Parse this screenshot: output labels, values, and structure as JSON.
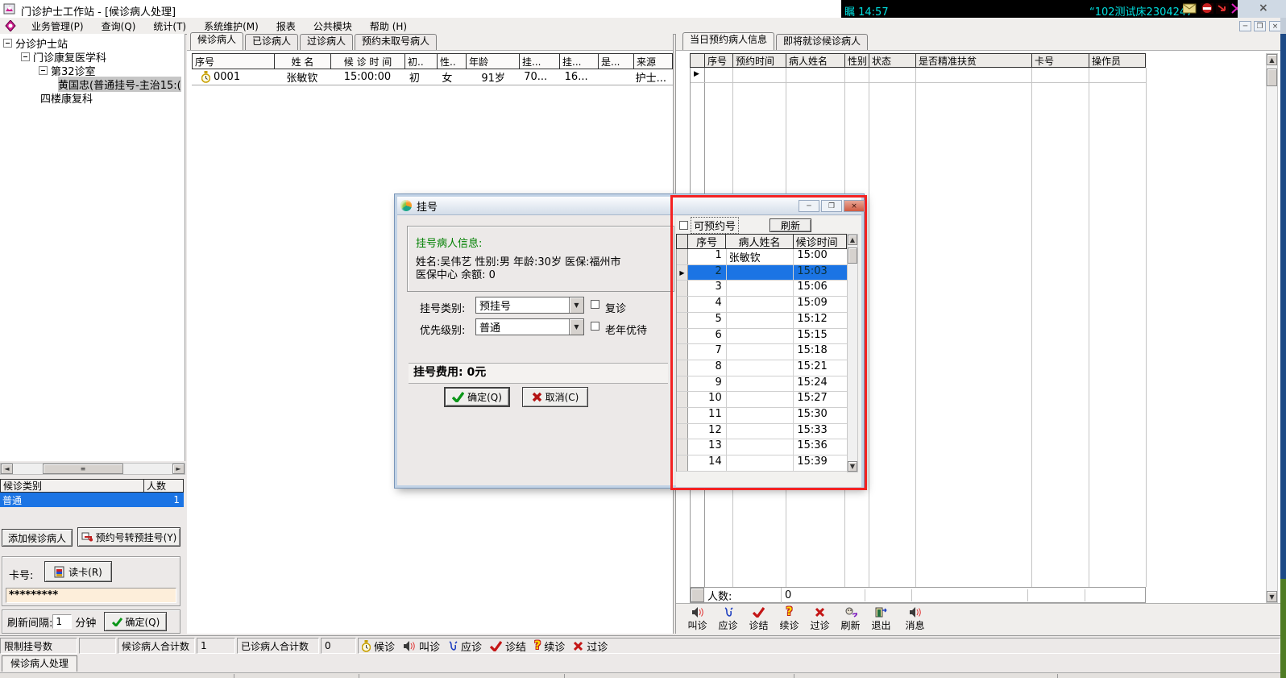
{
  "window": {
    "title": "门诊护士工作站 - [候诊病人处理]",
    "close_glyph": "×"
  },
  "tray": {
    "time": "瞩 14:57",
    "device": "“102测试床2304247"
  },
  "menu": [
    "业务管理(P)",
    "查询(Q)",
    "统计(T)",
    "系统维护(M)",
    "报表",
    "公共模块",
    "帮助 (H)"
  ],
  "tree": [
    "分诊护士站",
    "门诊康复医学科",
    "第32诊室",
    "黄国忠(普通挂号-主治15:(",
    "四楼康复科"
  ],
  "center": {
    "tabs": [
      "候诊病人",
      "已诊病人",
      "过诊病人",
      "预约未取号病人"
    ],
    "columns": [
      "序号",
      "姓  名",
      "候 诊 时 间",
      "初..",
      "性..",
      "年龄",
      "挂...",
      "挂...",
      "是...",
      "来源"
    ],
    "row": {
      "no": "0001",
      "name": "张敏钦",
      "time": "15:00:00",
      "first": "初",
      "sex": "女",
      "age": "91岁",
      "fee": "70...",
      "num": "16...",
      "flag": "",
      "source": "护士..."
    }
  },
  "right": {
    "tabs": [
      "当日预约病人信息",
      "即将就诊候诊病人"
    ],
    "columns": [
      "序号",
      "预约时间",
      "病人姓名",
      "性别",
      "状态",
      "是否精准扶贫",
      "卡号",
      "操作员"
    ],
    "footer_label": "人数:",
    "footer_value": "0",
    "toolbar": [
      {
        "label": "叫诊"
      },
      {
        "label": "应诊"
      },
      {
        "label": "诊结"
      },
      {
        "label": "续诊"
      },
      {
        "label": "过诊"
      },
      {
        "label": "刷新"
      },
      {
        "label": "退出"
      },
      {
        "label": "消息"
      }
    ]
  },
  "dialog": {
    "title": "挂号",
    "info_title": "挂号病人信息:",
    "info_line1": "姓名:吴伟艺 性别:男 年龄:30岁 医保:福州市",
    "info_line2": "医保中心 余额: 0",
    "reg_label": "挂号类别:",
    "reg_value": "预挂号",
    "pri_label": "优先级别:",
    "pri_value": "普通",
    "revisit": "复诊",
    "elderly": "老年优待",
    "fee": "挂号费用: 0元",
    "ok": "确定(Q)",
    "cancel": "取消(C)"
  },
  "slots": {
    "checkbox": "可预约号",
    "refresh": "刷新",
    "columns": [
      "序号",
      "病人姓名",
      "候诊时间"
    ],
    "rows": [
      {
        "no": "1",
        "name": "张敏钦",
        "time": "15:00"
      },
      {
        "no": "2",
        "name": "",
        "time": "15:03"
      },
      {
        "no": "3",
        "name": "",
        "time": "15:06"
      },
      {
        "no": "4",
        "name": "",
        "time": "15:09"
      },
      {
        "no": "5",
        "name": "",
        "time": "15:12"
      },
      {
        "no": "6",
        "name": "",
        "time": "15:15"
      },
      {
        "no": "7",
        "name": "",
        "time": "15:18"
      },
      {
        "no": "8",
        "name": "",
        "time": "15:21"
      },
      {
        "no": "9",
        "name": "",
        "time": "15:24"
      },
      {
        "no": "10",
        "name": "",
        "time": "15:27"
      },
      {
        "no": "11",
        "name": "",
        "time": "15:30"
      },
      {
        "no": "12",
        "name": "",
        "time": "15:33"
      },
      {
        "no": "13",
        "name": "",
        "time": "15:36"
      },
      {
        "no": "14",
        "name": "",
        "time": "15:39"
      }
    ]
  },
  "left": {
    "cat_col1": "候诊类别",
    "cat_col2": "人数",
    "cat_name": "普通",
    "cat_count": "1",
    "add": "添加候诊病人",
    "transfer": "预约号转预挂号(Y)",
    "card_label": "卡号:",
    "read": "读卡(R)",
    "card_value": "*********",
    "interval_label": "刷新间隔:",
    "interval_value": "1",
    "minutes": "分钟",
    "ok": "确定(Q)"
  },
  "status": {
    "limit": "限制挂号数",
    "wait_label": "候诊病人合计数",
    "wait_value": "1",
    "done_label": "已诊病人合计数",
    "done_value": "0",
    "legend": [
      {
        "label": "候诊"
      },
      {
        "label": "叫诊"
      },
      {
        "label": "应诊"
      },
      {
        "label": "诊结"
      },
      {
        "label": "续诊"
      },
      {
        "label": "过诊"
      }
    ]
  },
  "bottom_tab": "候诊病人处理"
}
